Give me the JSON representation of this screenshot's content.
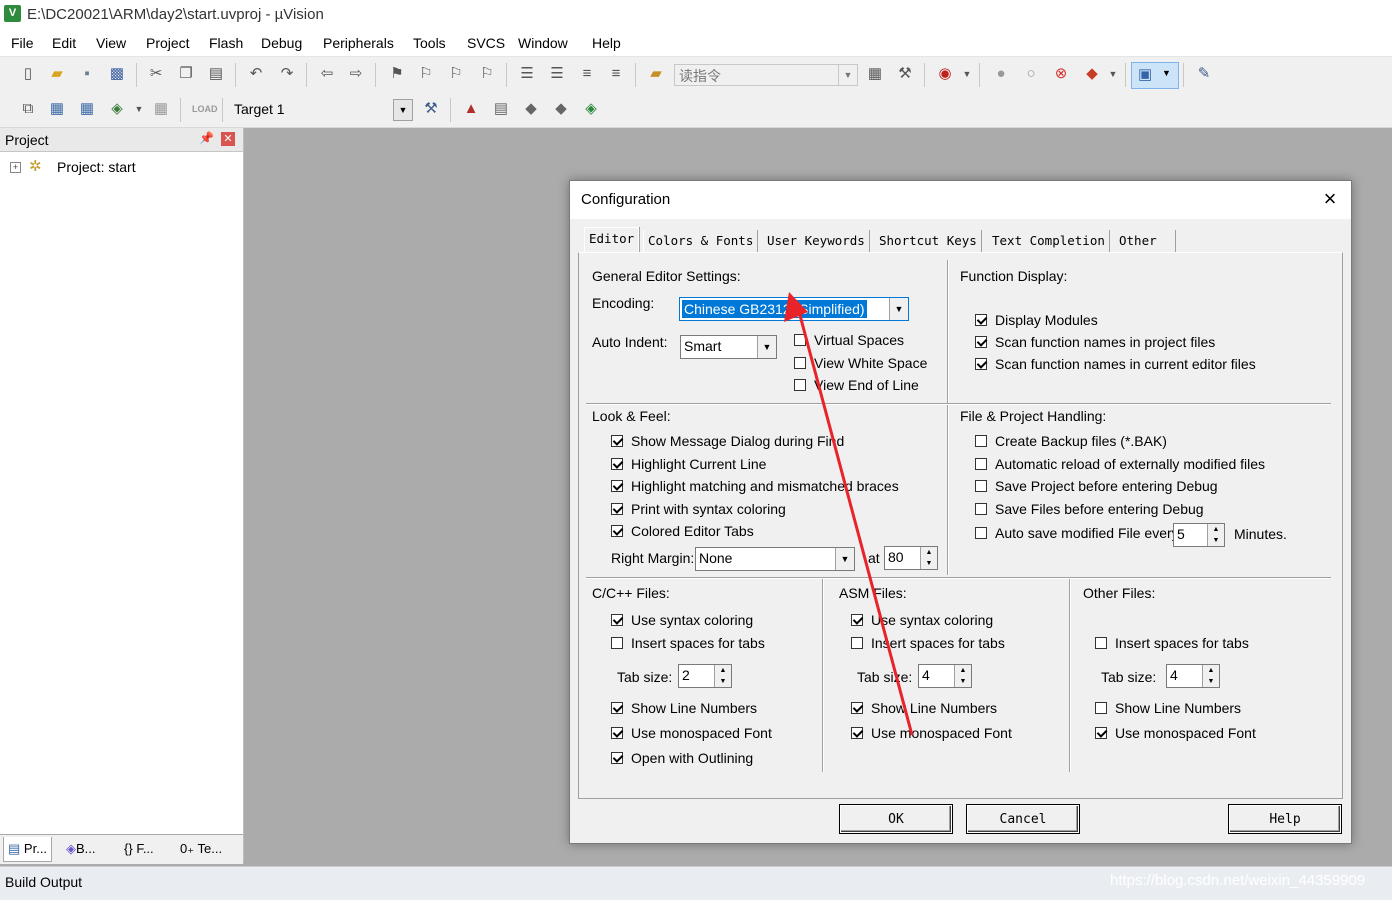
{
  "window": {
    "title": "E:\\DC20021\\ARM\\day2\\start.uvproj - µVision"
  },
  "menu": [
    "File",
    "Edit",
    "View",
    "Project",
    "Flash",
    "Debug",
    "Peripherals",
    "Tools",
    "SVCS",
    "Window",
    "Help"
  ],
  "toolbar": {
    "find_text": "读指令",
    "target": "Target 1"
  },
  "project_panel": {
    "header": "Project",
    "pin_icon": "pin-icon",
    "close_icon": "close-icon",
    "tree_root": "Project: start",
    "tabs": [
      "Pr...",
      "B...",
      "F...",
      "Te..."
    ]
  },
  "build_output": {
    "label": "Build Output"
  },
  "watermark": "https://blog.csdn.net/weixin_44359909",
  "dialog": {
    "title": "Configuration",
    "tabs": [
      "Editor",
      "Colors & Fonts",
      "User Keywords",
      "Shortcut Keys",
      "Text Completion",
      "Other"
    ],
    "general": {
      "heading": "General Editor Settings:",
      "encoding_label": "Encoding:",
      "encoding_value": "Chinese GB2312 (Simplified)",
      "auto_indent_label": "Auto Indent:",
      "auto_indent_value": "Smart",
      "virtual_spaces": "Virtual Spaces",
      "view_white_space": "View White Space",
      "view_end_of_line": "View End of Line"
    },
    "function_display": {
      "heading": "Function Display:",
      "display_modules": "Display Modules",
      "scan_project": "Scan function names in project files",
      "scan_editor": "Scan function names in current editor files"
    },
    "look_feel": {
      "heading": "Look & Feel:",
      "show_message": "Show Message Dialog during Find",
      "highlight_line": "Highlight Current Line",
      "highlight_braces": "Highlight matching and mismatched braces",
      "print_syntax": "Print with syntax coloring",
      "colored_tabs": "Colored Editor Tabs",
      "right_margin_label": "Right Margin:",
      "right_margin_value": "None",
      "at_label": "at",
      "at_value": "80"
    },
    "file_project": {
      "heading": "File & Project Handling:",
      "create_backup": "Create Backup files (*.BAK)",
      "auto_reload": "Automatic reload of externally modified files",
      "save_project": "Save Project before entering Debug",
      "save_files": "Save Files before entering Debug",
      "auto_save_label": "Auto save modified File every",
      "auto_save_value": "5",
      "minutes": "Minutes."
    },
    "c_files": {
      "heading": "C/C++ Files:",
      "syntax_coloring": "Use syntax coloring",
      "insert_spaces": "Insert spaces for tabs",
      "tab_size_label": "Tab size:",
      "tab_size_value": "2",
      "line_numbers": "Show Line Numbers",
      "monospaced": "Use monospaced Font",
      "outlining": "Open with Outlining"
    },
    "asm_files": {
      "heading": "ASM Files:",
      "syntax_coloring": "Use syntax coloring",
      "insert_spaces": "Insert spaces for tabs",
      "tab_size_label": "Tab size:",
      "tab_size_value": "4",
      "line_numbers": "Show Line Numbers",
      "monospaced": "Use monospaced Font"
    },
    "other_files": {
      "heading": "Other Files:",
      "insert_spaces": "Insert spaces for tabs",
      "tab_size_label": "Tab size:",
      "tab_size_value": "4",
      "line_numbers": "Show Line Numbers",
      "monospaced": "Use monospaced Font"
    },
    "buttons": {
      "ok": "OK",
      "cancel": "Cancel",
      "help": "Help"
    }
  },
  "annotation_color": "#e8232a",
  "selection_color": "#0078d7"
}
